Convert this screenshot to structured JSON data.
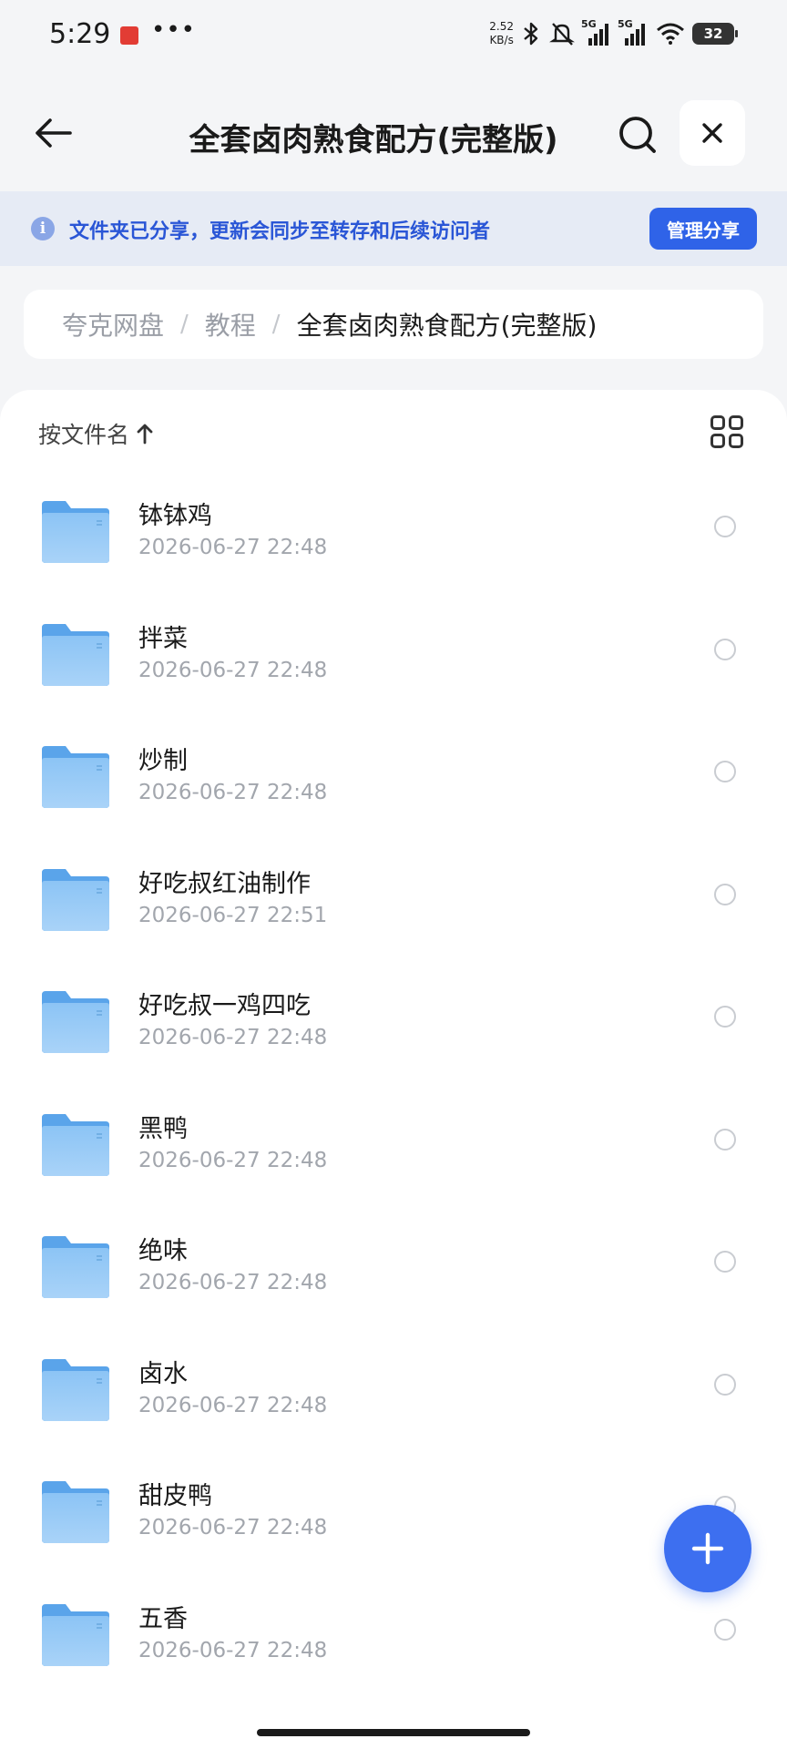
{
  "status_bar": {
    "time": "5:29",
    "net_speed_value": "2.52",
    "net_speed_unit": "KB/s",
    "signal1_label": "5G",
    "signal2_label": "5G",
    "battery": "32"
  },
  "header": {
    "title": "全套卤肉熟食配方(完整版)"
  },
  "share_banner": {
    "text": "文件夹已分享，更新会同步至转存和后续访问者",
    "manage_label": "管理分享"
  },
  "breadcrumb": [
    "夸克网盘",
    "教程",
    "全套卤肉熟食配方(完整版)"
  ],
  "sort": {
    "label": "按文件名"
  },
  "files": [
    {
      "name": "钵钵鸡",
      "date": "2026-06-27 22:48"
    },
    {
      "name": "拌菜",
      "date": "2026-06-27 22:48"
    },
    {
      "name": "炒制",
      "date": "2026-06-27 22:48"
    },
    {
      "name": "好吃叔红油制作",
      "date": "2026-06-27 22:51"
    },
    {
      "name": "好吃叔一鸡四吃",
      "date": "2026-06-27 22:48"
    },
    {
      "name": "黑鸭",
      "date": "2026-06-27 22:48"
    },
    {
      "name": "绝味",
      "date": "2026-06-27 22:48"
    },
    {
      "name": "卤水",
      "date": "2026-06-27 22:48"
    },
    {
      "name": "甜皮鸭",
      "date": "2026-06-27 22:48"
    },
    {
      "name": "五香",
      "date": "2026-06-27 22:48"
    }
  ],
  "colors": {
    "accent": "#2f63e8",
    "banner_bg": "#e6ebf5",
    "folder": "#6fb0f0"
  }
}
